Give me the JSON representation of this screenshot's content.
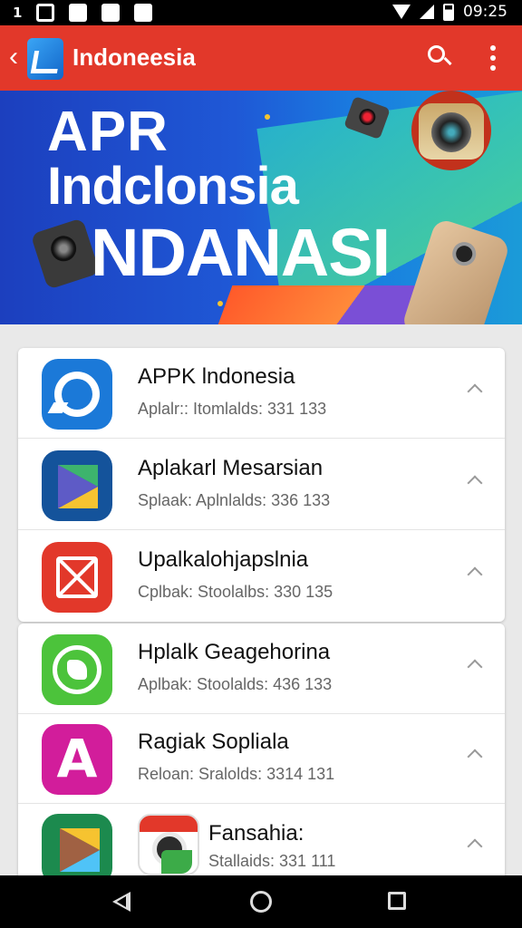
{
  "status_bar": {
    "left_text": "1",
    "time": "09:25"
  },
  "app_bar": {
    "title": "Indoneesia"
  },
  "banner": {
    "line1": "APR",
    "line2": "Indclonsia",
    "line3": "NDANASI"
  },
  "apps": [
    {
      "name": "APPK lndonesia",
      "meta": "Aplalr:: Itomlalds: 331 133",
      "icon": "circle-app-icon"
    },
    {
      "name": "Aplakarl Mesarsian",
      "meta": "Splaak: Aplnlalds: 336 133",
      "icon": "play-triangle-icon"
    },
    {
      "name": "Upalkalohjapslnia",
      "meta": "Cplbak: Stoolalbs: 330 135",
      "icon": "envelope-x-icon"
    },
    {
      "name": "Hplalk Geagehorina",
      "meta": "Aplbak: Stoolalds: 436 133",
      "icon": "chat-phone-icon"
    },
    {
      "name": "Ragiak Sopliala",
      "meta": "Reloan: Sralolds: 3314 131",
      "icon": "letter-a-icon"
    },
    {
      "name": "Fansahia:",
      "meta": "Stallaids: 331 111",
      "icon": "play-triangle-icon"
    }
  ],
  "colors": {
    "app_bar": "#e2382a",
    "banner_blue": "#1f58d6"
  }
}
